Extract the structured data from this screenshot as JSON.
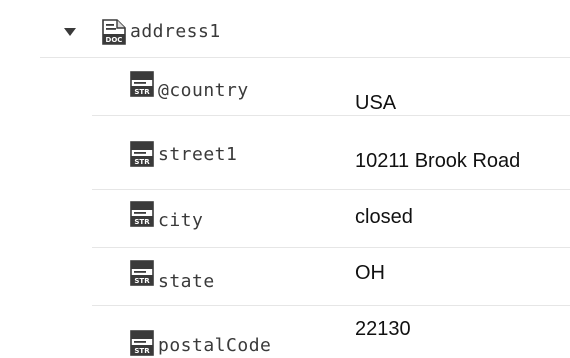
{
  "tree": {
    "parent": {
      "label": "address1",
      "icon": "doc-icon",
      "expanded": true
    },
    "fields": [
      {
        "key": "@country",
        "value": "USA",
        "icon": "str-icon"
      },
      {
        "key": "street1",
        "value": "10211 Brook Road",
        "icon": "str-icon"
      },
      {
        "key": "city",
        "value": "closed",
        "icon": "str-icon"
      },
      {
        "key": "state",
        "value": "OH",
        "icon": "str-icon"
      },
      {
        "key": "postalCode",
        "value": "22130",
        "icon": "str-icon"
      }
    ]
  }
}
